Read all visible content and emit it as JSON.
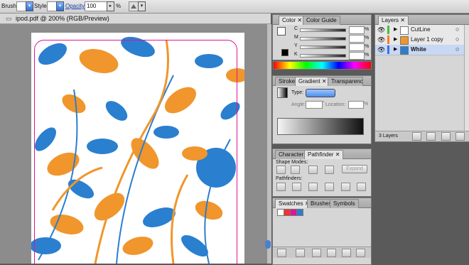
{
  "control_bar": {
    "brush_label": "Brush:",
    "style_label": "Style:",
    "opacity_label": "Opacity:",
    "opacity_value": "100",
    "opacity_unit": "%"
  },
  "document": {
    "tab_title": "ipod.pdf @ 200% (RGB/Preview)"
  },
  "color_panel": {
    "tabs": [
      "Color",
      "Color Guide"
    ],
    "channels": [
      "C",
      "M",
      "Y",
      "K"
    ],
    "units": "%"
  },
  "gradient_panel": {
    "tabs": [
      "Stroke",
      "Gradient",
      "Transparency"
    ],
    "type_label": "Type:",
    "angle_label": "Angle:",
    "location_label": "Location:",
    "angle_unit": "°",
    "location_unit": "%"
  },
  "pathfinder_panel": {
    "tabs": [
      "Character",
      "Pathfinder"
    ],
    "shape_modes_label": "Shape Modes:",
    "pathfinders_label": "Pathfinders:",
    "expand_label": "Expand"
  },
  "swatches_panel": {
    "tabs": [
      "Swatches",
      "Brushes",
      "Symbols"
    ]
  },
  "layers_panel": {
    "tab": "Layers",
    "layers": [
      {
        "name": "CutLine",
        "color": "#40c040"
      },
      {
        "name": "Layer 1 copy",
        "color": "#ff7b2a"
      },
      {
        "name": "White",
        "color": "#3a6fe8",
        "selected": true
      }
    ],
    "count": "3 Layers"
  },
  "colors": {
    "orange": "#f0962c",
    "blue": "#2a7fcf",
    "magenta": "#e0139a"
  }
}
